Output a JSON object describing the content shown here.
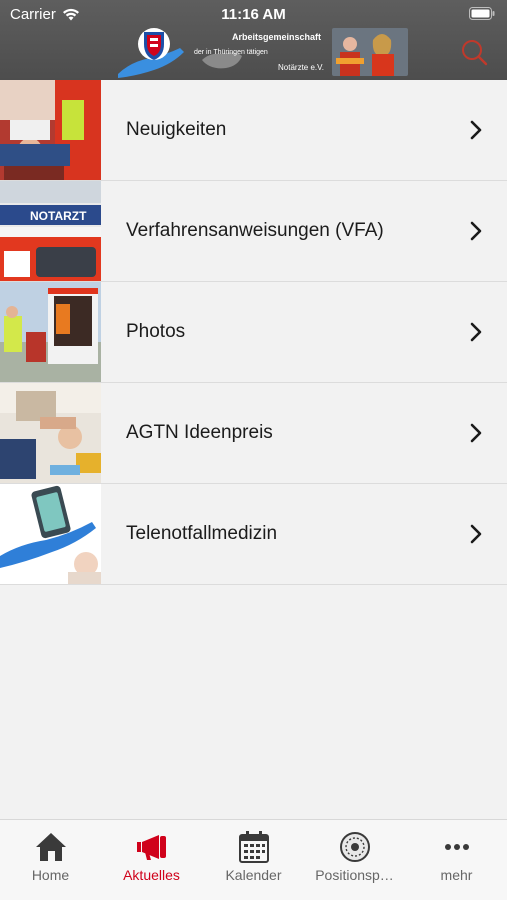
{
  "status_bar": {
    "carrier": "Carrier",
    "time": "11:16 AM"
  },
  "header": {
    "banner_line1": "Arbeitsgemeinschaft",
    "banner_line2": "der in Thüringen tätigen",
    "banner_line3": "Notärzte e.V.",
    "search_icon": "search-icon"
  },
  "menu": {
    "items": [
      {
        "label": "Neuigkeiten"
      },
      {
        "label": "Verfahrensanweisungen (VFA)"
      },
      {
        "label": "Photos"
      },
      {
        "label": "AGTN Ideenpreis"
      },
      {
        "label": "Telenotfallmedizin"
      }
    ],
    "thumb_text_notarzt": "NOTARZT"
  },
  "tabbar": {
    "tabs": [
      {
        "label": "Home",
        "icon": "home-icon"
      },
      {
        "label": "Aktuelles",
        "icon": "megaphone-icon",
        "active": true
      },
      {
        "label": "Kalender",
        "icon": "calendar-icon"
      },
      {
        "label": "Positionsp…",
        "icon": "stamp-icon"
      },
      {
        "label": "mehr",
        "icon": "more-icon"
      }
    ]
  },
  "colors": {
    "accent": "#d0021b",
    "header": "#555555",
    "background": "#f2f2f2"
  }
}
